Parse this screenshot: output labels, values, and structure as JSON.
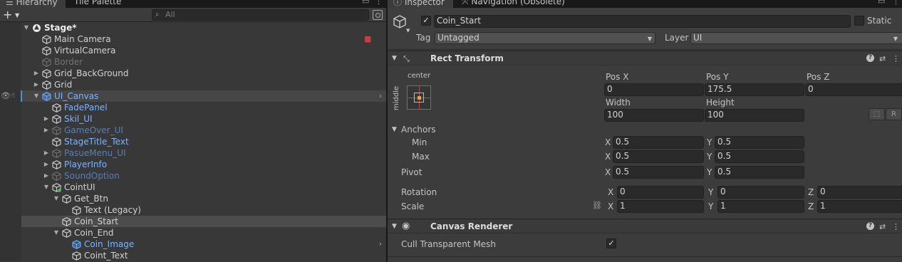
{
  "hierarchy": {
    "tabs": [
      "Hierarchy",
      "Tile Palette"
    ],
    "search_placeholder": "All",
    "rows": [
      {
        "label": "Stage*",
        "style": "c-white",
        "indent": 0,
        "fold": "▼",
        "icon": "unity-scene-icon"
      },
      {
        "label": "Main Camera",
        "style": "c-norm",
        "indent": 1,
        "fold": "",
        "icon": "gameobject-cube-icon"
      },
      {
        "label": "VirtualCamera",
        "style": "c-norm",
        "indent": 1,
        "fold": "",
        "icon": "gameobject-cube-icon"
      },
      {
        "label": "Border",
        "style": "c-grey",
        "indent": 1,
        "fold": "",
        "icon": "gameobject-cube-icon"
      },
      {
        "label": "Grid_BackGround",
        "style": "c-norm",
        "indent": 1,
        "fold": "▶",
        "icon": "gameobject-cube-icon"
      },
      {
        "label": "Grid",
        "style": "c-norm",
        "indent": 1,
        "fold": "▶",
        "icon": "gameobject-cube-icon"
      },
      {
        "label": "UI_Canvas",
        "style": "c-blue",
        "indent": 1,
        "fold": "▼",
        "icon": "prefab-cube-icon"
      },
      {
        "label": "FadePanel",
        "style": "c-blue",
        "indent": 2,
        "fold": "",
        "icon": "gameobject-cube-icon"
      },
      {
        "label": "Skil_UI",
        "style": "c-blue",
        "indent": 2,
        "fold": "▶",
        "icon": "gameobject-cube-icon"
      },
      {
        "label": "GameOver_UI",
        "style": "c-dblue",
        "indent": 2,
        "fold": "▶",
        "icon": "gameobject-cube-icon"
      },
      {
        "label": "StageTitle_Text",
        "style": "c-blue",
        "indent": 2,
        "fold": "",
        "icon": "gameobject-cube-icon"
      },
      {
        "label": "PasueMenu_UI",
        "style": "c-dblue",
        "indent": 2,
        "fold": "▶",
        "icon": "gameobject-cube-icon"
      },
      {
        "label": "PlayerInfo",
        "style": "c-blue",
        "indent": 2,
        "fold": "▶",
        "icon": "gameobject-cube-icon"
      },
      {
        "label": "SoundOption",
        "style": "c-dblue",
        "indent": 2,
        "fold": "▶",
        "icon": "gameobject-cube-icon"
      },
      {
        "label": "CointUI",
        "style": "c-norm",
        "indent": 2,
        "fold": "▼",
        "icon": "gameobject-cube-icon"
      },
      {
        "label": "Get_Btn",
        "style": "c-norm",
        "indent": 3,
        "fold": "▼",
        "icon": "gameobject-cube-icon"
      },
      {
        "label": "Text (Legacy)",
        "style": "c-norm",
        "indent": 4,
        "fold": "",
        "icon": "gameobject-cube-icon"
      },
      {
        "label": "Coin_Start",
        "style": "c-norm",
        "indent": 3,
        "fold": "",
        "icon": "gameobject-cube-icon"
      },
      {
        "label": "Coin_End",
        "style": "c-norm",
        "indent": 3,
        "fold": "▼",
        "icon": "gameobject-cube-icon"
      },
      {
        "label": "Coin_Image",
        "style": "c-blue",
        "indent": 4,
        "fold": "",
        "icon": "prefab-cube-icon"
      },
      {
        "label": "Coint_Text",
        "style": "c-norm",
        "indent": 4,
        "fold": "",
        "icon": "gameobject-cube-icon"
      }
    ]
  },
  "inspector": {
    "tabs": [
      "Inspector",
      "Navigation (Obsolete)"
    ],
    "object_name": "Coin_Start",
    "active_checked": "✓",
    "static_label": "Static",
    "tag_label": "Tag",
    "tag_value": "Untagged",
    "layer_label": "Layer",
    "layer_value": "UI",
    "rect_transform": {
      "title": "Rect Transform",
      "anchor_h_label": "center",
      "anchor_v_label": "middle",
      "pos_x_label": "Pos X",
      "pos_x": "0",
      "pos_y_label": "Pos Y",
      "pos_y": "175.5",
      "pos_z_label": "Pos Z",
      "pos_z": "0",
      "width_label": "Width",
      "width": "100",
      "height_label": "Height",
      "height": "100",
      "r_button": "R",
      "anchors_label": "Anchors",
      "min_label": "Min",
      "min_x": "0.5",
      "min_y": "0.5",
      "max_label": "Max",
      "max_x": "0.5",
      "max_y": "0.5",
      "pivot_label": "Pivot",
      "pivot_x": "0.5",
      "pivot_y": "0.5",
      "rotation_label": "Rotation",
      "rot_x": "0",
      "rot_y": "0",
      "rot_z": "0",
      "scale_label": "Scale",
      "scale_x": "1",
      "scale_y": "1",
      "scale_z": "1",
      "x": "X",
      "y": "Y",
      "z": "Z"
    },
    "canvas_renderer": {
      "title": "Canvas Renderer",
      "cull_label": "Cull Transparent Mesh",
      "cull_checked": "✓"
    }
  }
}
